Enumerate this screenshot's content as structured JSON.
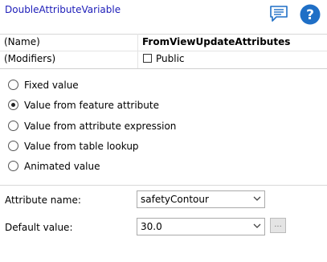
{
  "header": {
    "title": "DoubleAttributeVariable",
    "comment_icon": "comment-icon",
    "help_icon": "help-icon",
    "help_color": "#1f6fc6",
    "comment_color": "#1f6fc6"
  },
  "properties": [
    {
      "name": "(Name)",
      "value": "FromViewUpdateAttributes"
    },
    {
      "name": "(Modifiers)",
      "checkbox_label": "Public",
      "checked": false
    }
  ],
  "value_source": {
    "options": [
      "Fixed value",
      "Value from feature attribute",
      "Value from attribute expression",
      "Value from table lookup",
      "Animated value"
    ],
    "selected": "Value from feature attribute"
  },
  "fields": {
    "attribute_name_label": "Attribute name:",
    "attribute_name_value": "safetyContour",
    "default_value_label": "Default value:",
    "default_value_value": "30.0",
    "ellipsis_label": "..."
  }
}
